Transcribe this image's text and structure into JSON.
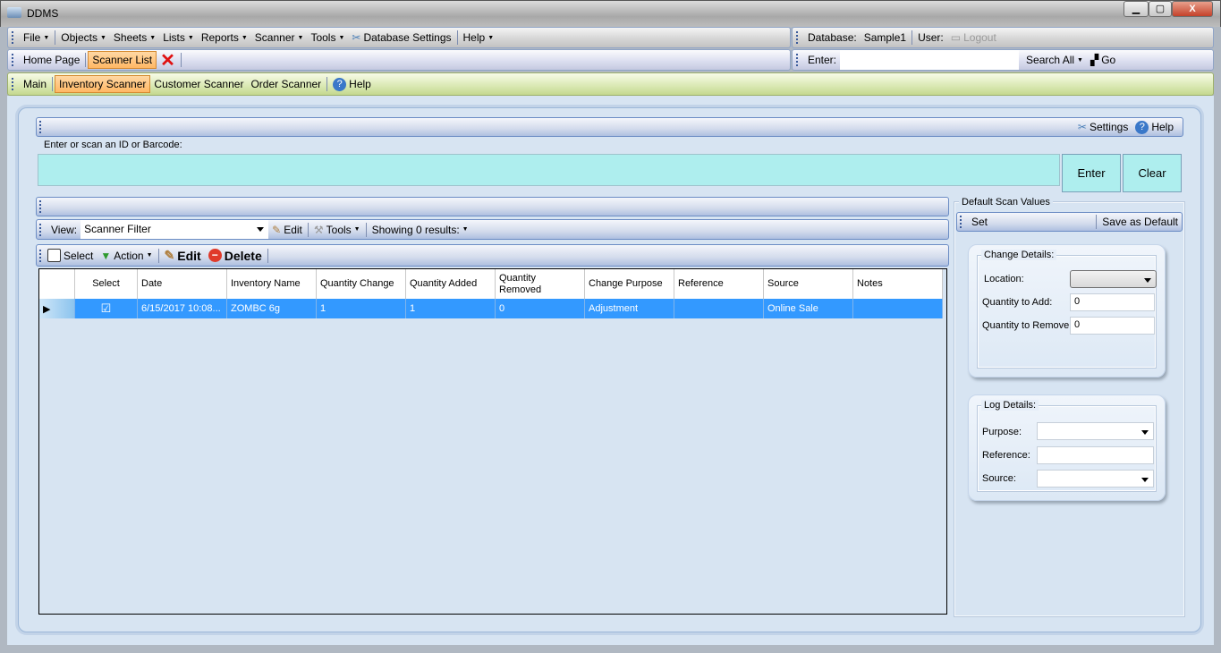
{
  "window": {
    "title": "DDMS",
    "minimize": "▁",
    "maximize": "▢",
    "close": "X"
  },
  "menu": {
    "items": [
      "File",
      "Objects",
      "Sheets",
      "Lists",
      "Reports",
      "Scanner",
      "Tools"
    ],
    "db_settings": "Database Settings",
    "help": "Help",
    "database_label": "Database:",
    "database_value": "Sample1",
    "user_label": "User:",
    "logout": "Logout"
  },
  "tabs": {
    "home": "Home Page",
    "scanner_list": "Scanner List",
    "enter_label": "Enter:",
    "enter_value": "",
    "search_all": "Search All",
    "go": "Go"
  },
  "subnav": {
    "items": [
      "Main",
      "Inventory Scanner",
      "Customer Scanner",
      "Order Scanner"
    ],
    "help": "Help"
  },
  "scan": {
    "settings": "Settings",
    "help": "Help",
    "prompt": "Enter or scan an ID or Barcode:",
    "value": "",
    "enter": "Enter",
    "clear": "Clear"
  },
  "view": {
    "label": "View:",
    "value": "Scanner Filter",
    "edit": "Edit",
    "tools": "Tools",
    "showing": "Showing 0 results:"
  },
  "actions": {
    "select": "Select",
    "action": "Action",
    "edit": "Edit",
    "delete": "Delete"
  },
  "grid": {
    "columns": [
      "Select",
      "Date",
      "Inventory Name",
      "Quantity Change",
      "Quantity Added",
      "Quantity Removed",
      "Change Purpose",
      "Reference",
      "Source",
      "Notes"
    ],
    "rows": [
      {
        "select": "☑",
        "date": "6/15/2017 10:08...",
        "name": "ZOMBC 6g",
        "change": "1",
        "added": "1",
        "removed": "0",
        "purpose": "Adjustment",
        "reference": "",
        "source": "Online Sale",
        "notes": ""
      }
    ]
  },
  "defaults": {
    "title": "Default Scan Values",
    "set": "Set",
    "save": "Save as Default",
    "change": {
      "title": "Change Details:",
      "location_label": "Location:",
      "location_value": "",
      "add_label": "Quantity to Add:",
      "add_value": "0",
      "remove_label": "Quantity to Remove:",
      "remove_value": "0"
    },
    "log": {
      "title": "Log Details:",
      "purpose_label": "Purpose:",
      "purpose_value": "",
      "reference_label": "Reference:",
      "reference_value": "",
      "source_label": "Source:",
      "source_value": ""
    }
  }
}
